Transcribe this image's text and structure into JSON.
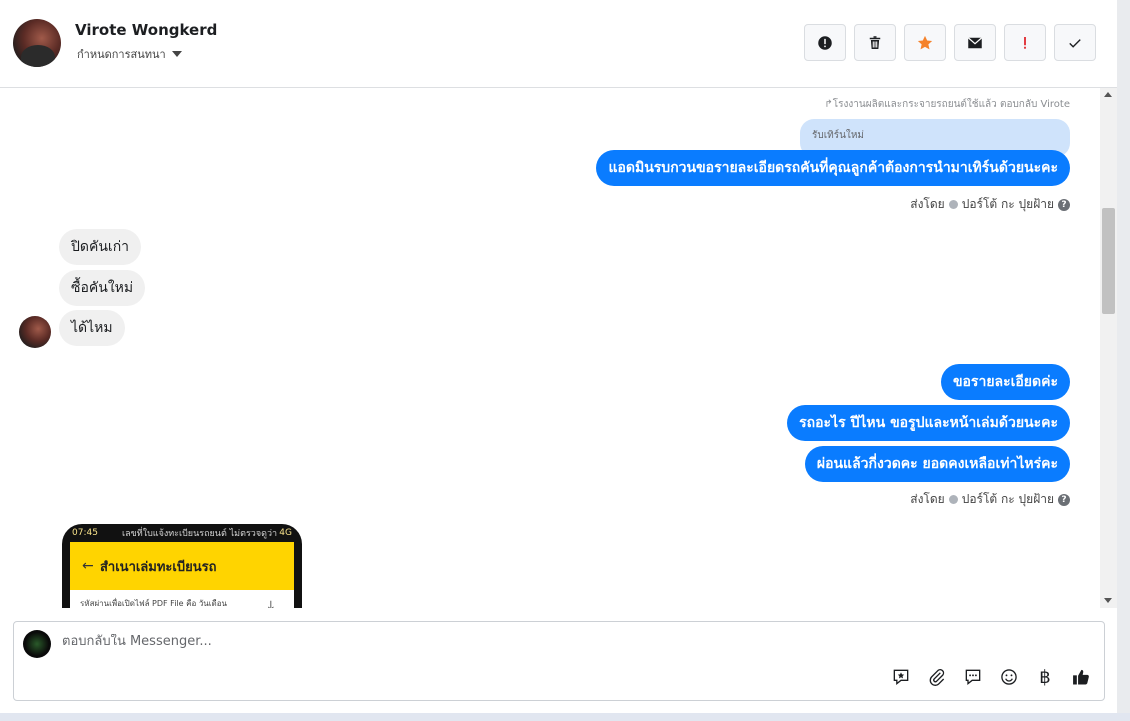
{
  "header": {
    "contact_name": "Virote Wongkerd",
    "conversation_settings": "กำหนดการสนทนา",
    "actions": [
      "alert-icon",
      "trash-icon",
      "star-icon",
      "envelope-icon",
      "exclamation-icon",
      "checkmark-icon"
    ],
    "star_color": "#f5822a",
    "exclamation_color": "#e0282e"
  },
  "thread": {
    "reply_note": "↱โรงงานผลิตและกระจายรถยนต์ใช้แล้ว ตอบกลับ Virote",
    "quoted_text": "รับเทิร์นใหม่",
    "outgoing_1": "แอดมินรบกวนขอรายละเอียดรถคันที่คุณลูกค้าต้องการนำมาเทิร์นด้วยนะคะ",
    "sent_by_1": "ส่งโดย",
    "sender_name_1": "ปอร์โต้ กะ ปุยฝ้าย",
    "incoming": [
      "ปิดคันเก่า",
      "ซื้อคันใหม่",
      "ได้ไหม"
    ],
    "outgoing_2": [
      "ขอรายละเอียดค่ะ",
      "รถอะไร ปีไหน ขอรูปและหน้าเล่มด้วยนะคะ",
      "ผ่อนแล้วกี่งวดคะ ยอดคงเหลือเท่าไหร่คะ"
    ],
    "sent_by_2": "ส่งโดย",
    "sender_name_2": "ปอร์โต้ กะ ปุยฝ้าย",
    "outgoing_color": "#0a7cff"
  },
  "attachment": {
    "status_left": "07:45",
    "status_right": "4G",
    "overlay_text": "เลขที่ใบแจ้งทะเบียนรถยนต์ ไม่ตรวจดูว่า",
    "title": "สำเนาเล่มทะเบียนรถ",
    "body_text": "รหัสผ่านเพื่อเปิดไฟล์ PDF File คือ วันเดือนปีเกิด",
    "back_glyph": "←",
    "download_glyph": "⤓"
  },
  "composer": {
    "placeholder": "ตอบกลับใน Messenger...",
    "tools": [
      "sticker-icon",
      "attachment-icon",
      "saved-reply-icon",
      "emoji-icon",
      "baht-icon",
      "like-icon"
    ],
    "baht_glyph": "฿"
  }
}
